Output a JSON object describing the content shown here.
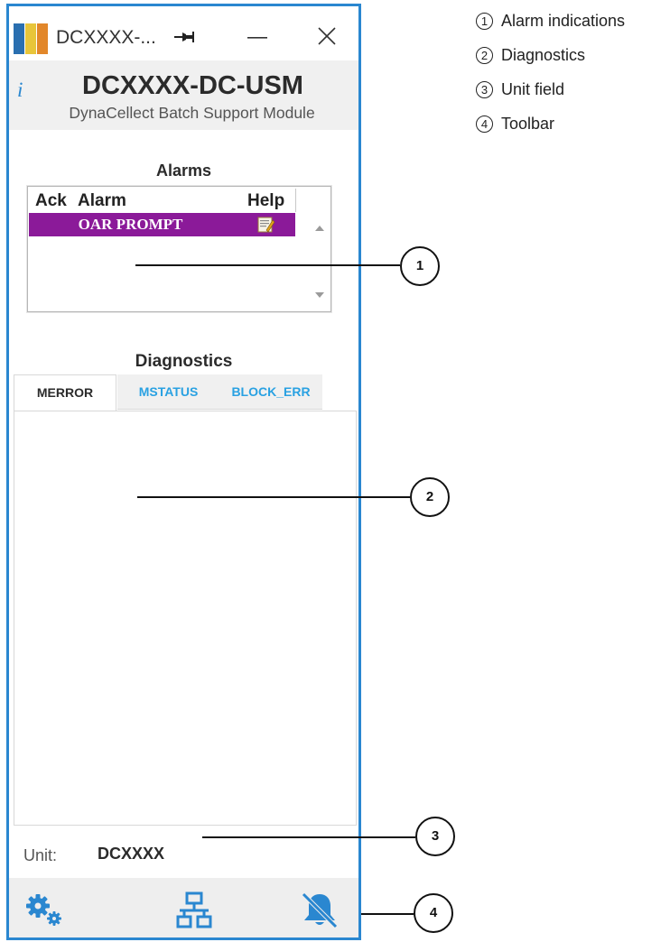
{
  "window": {
    "title": "DCXXXX-...",
    "device_title": "DCXXXX-DC-USM",
    "device_subtitle": "DynaCellect Batch Support Module",
    "info_glyph": "i"
  },
  "alarms": {
    "title": "Alarms",
    "columns": [
      "Ack",
      "Alarm",
      "Help"
    ],
    "rows": [
      {
        "name": "OAR PROMPT",
        "help_icon": "help-notepad-icon",
        "row_color": "#8b1a99"
      }
    ]
  },
  "diagnostics": {
    "title": "Diagnostics",
    "tabs": [
      {
        "label": "MERROR",
        "active": true
      },
      {
        "label": "MSTATUS",
        "active": false
      },
      {
        "label": "BLOCK_ERR",
        "active": false
      }
    ]
  },
  "unit": {
    "label": "Unit:",
    "value": "DCXXXX"
  },
  "toolbar": {
    "buttons": [
      "settings-gears-icon",
      "network-icon",
      "alarm-bell-muted-icon"
    ]
  },
  "callouts": [
    "1",
    "2",
    "3",
    "4"
  ],
  "legend": [
    {
      "num": "1",
      "text": "Alarm indications"
    },
    {
      "num": "2",
      "text": "Diagnostics"
    },
    {
      "num": "3",
      "text": "Unit field"
    },
    {
      "num": "4",
      "text": "Toolbar"
    }
  ],
  "colors": {
    "accent": "#2a87d0",
    "tab_link": "#29a1e2",
    "alarm_row": "#8b1a99",
    "toolbar_icon": "#2a87d0"
  }
}
